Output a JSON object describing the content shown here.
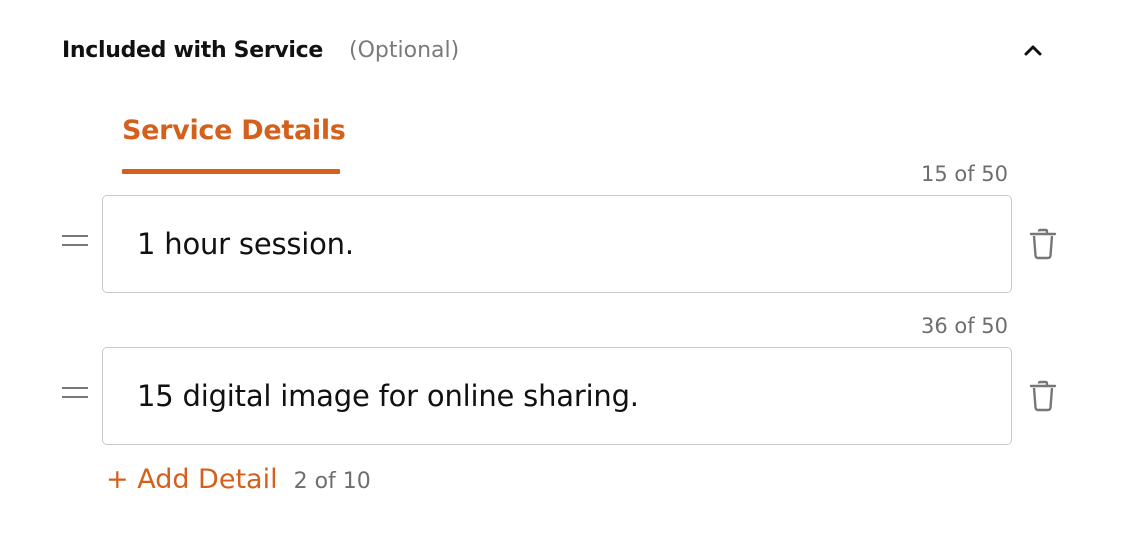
{
  "section": {
    "title": "Included with Service",
    "optional_label": "(Optional)",
    "collapse_icon": "chevron-up-icon"
  },
  "tab": {
    "label": "Service Details",
    "active": true,
    "color": "#d4601c"
  },
  "details": [
    {
      "value": "1 hour session.",
      "counter": "15 of 50",
      "drag_icon": "drag-handle-icon",
      "delete_icon": "trash-icon"
    },
    {
      "value": "15 digital image for online sharing.",
      "counter": "36 of 50",
      "drag_icon": "drag-handle-icon",
      "delete_icon": "trash-icon"
    }
  ],
  "add_detail": {
    "label": "+ Add Detail",
    "count": "2 of 10"
  },
  "colors": {
    "accent": "#d4601c",
    "muted_text": "#6e6e6e",
    "border": "#c8c8c8"
  }
}
